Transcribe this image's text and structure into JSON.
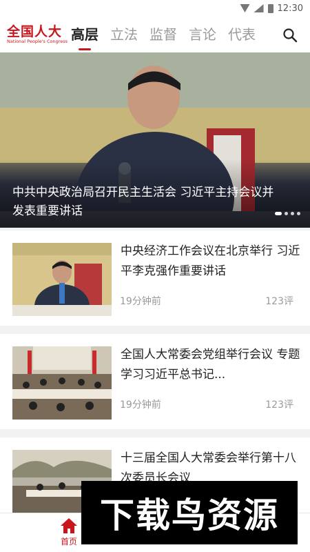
{
  "status_bar": {
    "time": "12:30"
  },
  "header": {
    "logo_cn": "全国人大",
    "logo_en": "National People's Congress",
    "tabs": [
      {
        "label": "高层",
        "active": true
      },
      {
        "label": "立法"
      },
      {
        "label": "监督"
      },
      {
        "label": "言论"
      },
      {
        "label": "代表"
      }
    ]
  },
  "hero": {
    "title": "中共中央政治局召开民主生活会 习近平主持会议并发表重要讲话"
  },
  "news": [
    {
      "title": "中央经济工作会议在北京举行 习近平李克强作重要讲话",
      "time": "19分钟前",
      "comments": "123评"
    },
    {
      "title": "全国人大常委会党组举行会议 专题学习习近平总书记...",
      "time": "19分钟前",
      "comments": "123评"
    },
    {
      "title": "十三届全国人大常委会举行第十八次委员长会议",
      "time": "",
      "comments": ""
    }
  ],
  "bottom_nav": {
    "home_label": "首页"
  },
  "watermark": {
    "text": "下载鸟资源"
  },
  "colors": {
    "brand_red": "#c8161d",
    "tab_inactive": "#9a9a9a",
    "meta_gray": "#999999"
  }
}
